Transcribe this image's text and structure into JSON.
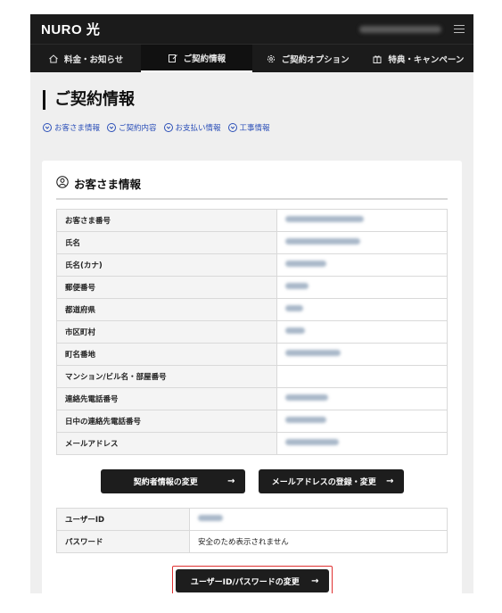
{
  "header": {
    "logo": "NURO 光"
  },
  "nav": {
    "items": [
      {
        "label": "料金・お知らせ",
        "icon": "home-icon"
      },
      {
        "label": "ご契約情報",
        "icon": "edit-icon",
        "active": true
      },
      {
        "label": "ご契約オプション",
        "icon": "gear-icon"
      },
      {
        "label": "特典・キャンペーン",
        "icon": "gift-icon"
      }
    ]
  },
  "page": {
    "title": "ご契約情報"
  },
  "anchors": [
    "お客さま情報",
    "ご契約内容",
    "お支払い情報",
    "工事情報"
  ],
  "customer": {
    "section_title": "お客さま情報",
    "rows": [
      {
        "label": "お客さま番号"
      },
      {
        "label": "氏名"
      },
      {
        "label": "氏名(カナ)"
      },
      {
        "label": "郵便番号"
      },
      {
        "label": "都道府県"
      },
      {
        "label": "市区町村"
      },
      {
        "label": "町名番地"
      },
      {
        "label": "マンション/ビル名・部屋番号"
      },
      {
        "label": "連絡先電話番号"
      },
      {
        "label": "日中の連絡先電話番号"
      },
      {
        "label": "メールアドレス"
      }
    ],
    "buttons": {
      "change_contractor": "契約者情報の変更",
      "email_register": "メールアドレスの登録・変更"
    }
  },
  "credentials": {
    "rows": [
      {
        "label": "ユーザーID",
        "value": ""
      },
      {
        "label": "パスワード",
        "value": "安全のため表示されません"
      }
    ],
    "change_button": "ユーザーID/パスワードの変更"
  },
  "colors": {
    "header_bg": "#1b1b1b",
    "link": "#2b4fb8",
    "highlight": "#e03131"
  }
}
